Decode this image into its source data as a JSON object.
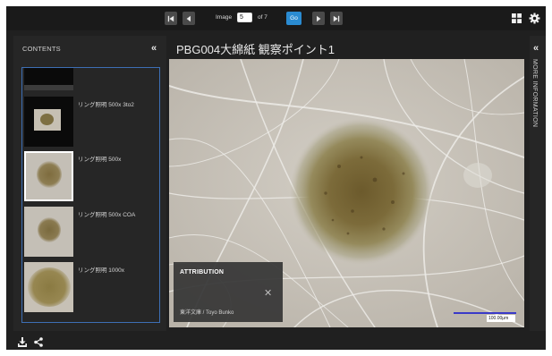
{
  "toolbar": {
    "image_label": "Image",
    "current_image": "5",
    "of_text": "of 7",
    "go_label": "Go"
  },
  "contents": {
    "title": "CONTENTS",
    "collapse_glyph": "«",
    "items": [
      {
        "label": ""
      },
      {
        "label": "リング照明 500x 3to2"
      },
      {
        "label": "リング照明 500x",
        "selected": true
      },
      {
        "label": "リング照明 500x COA"
      },
      {
        "label": "リング照明 1000x"
      }
    ]
  },
  "image": {
    "title": "PBG004大綿紙 観察ポイント1",
    "scale_label": "100.00μm"
  },
  "attribution": {
    "title": "ATTRIBUTION",
    "close_glyph": "✕",
    "text": "東洋文庫 / Toyo Bunko"
  },
  "more_information": {
    "label": "MORE INFORMATION",
    "collapse_glyph": "«"
  },
  "colors": {
    "accent": "#2a8bd1",
    "panel": "#262626",
    "background": "#202020",
    "selection_border": "#3d6fb5"
  },
  "icons": [
    "first-page-icon",
    "previous-icon",
    "next-icon",
    "last-page-icon",
    "grid-icon",
    "gear-icon",
    "download-icon",
    "share-icon"
  ]
}
